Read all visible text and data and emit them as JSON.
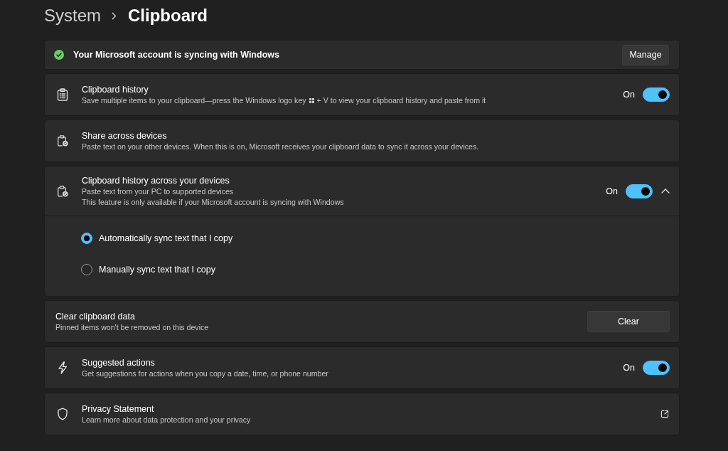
{
  "breadcrumb": [
    {
      "label": "System",
      "current": false
    },
    {
      "label": "Clipboard",
      "current": true
    }
  ],
  "sync_banner": {
    "text": "Your Microsoft account is syncing with Windows",
    "button": "Manage"
  },
  "settings": [
    {
      "kind": "toggle",
      "title": "Clipboard history",
      "description": [
        [
          "Save multiple items to your clipboard—press the Windows logo key",
          "+ V to view your clipboard history and paste from it"
        ]
      ],
      "state_label": "On",
      "on": true
    },
    {
      "kind": "info",
      "title": "Share across devices",
      "description": [
        [
          "Paste text on your other devices. When this is on, Microsoft receives your clipboard data to sync it across your devices."
        ]
      ]
    },
    {
      "kind": "expander",
      "title": "Clipboard history across your devices",
      "description": [
        [
          "Paste text from your PC to supported devices"
        ],
        [
          "This feature is only available if your Microsoft account is syncing with Windows"
        ]
      ],
      "state_label": "On",
      "on": true,
      "expanded": true,
      "options": [
        {
          "label": "Automatically sync text that I copy",
          "selected": true
        },
        {
          "label": "Manually sync text that I copy",
          "selected": false
        }
      ]
    },
    {
      "kind": "button",
      "title": "Clear clipboard data",
      "description": [
        [
          "Pinned items won't be removed on this device"
        ]
      ],
      "button": "Clear"
    },
    {
      "kind": "toggle",
      "title": "Suggested actions",
      "description": [
        [
          "Get suggestions for actions when you copy a date, time, or phone number"
        ]
      ],
      "state_label": "On",
      "on": true
    },
    {
      "kind": "link",
      "title": "Privacy Statement",
      "description": [
        [
          "Learn more about data protection and your privacy"
        ]
      ]
    }
  ]
}
